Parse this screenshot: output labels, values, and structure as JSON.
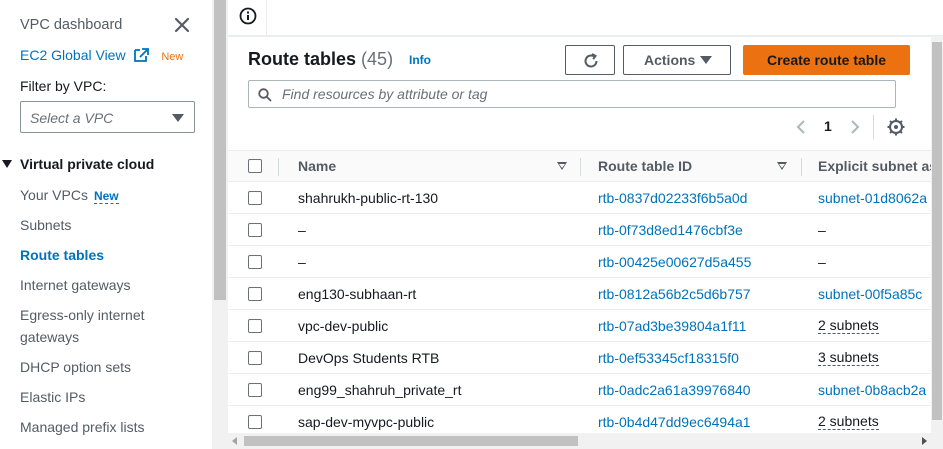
{
  "sidebar": {
    "title": "VPC dashboard",
    "ec2_link": "EC2 Global View",
    "ec2_badge": "New",
    "filter_label": "Filter by VPC:",
    "filter_placeholder": "Select a VPC",
    "section": "Virtual private cloud",
    "items": [
      {
        "label": "Your VPCs",
        "badge": "New"
      },
      {
        "label": "Subnets"
      },
      {
        "label": "Route tables"
      },
      {
        "label": "Internet gateways"
      },
      {
        "label": "Egress-only internet gateways"
      },
      {
        "label": "DHCP option sets"
      },
      {
        "label": "Elastic IPs"
      },
      {
        "label": "Managed prefix lists"
      }
    ]
  },
  "header": {
    "title": "Route tables",
    "count": "(45)",
    "info": "Info",
    "actions": "Actions",
    "create": "Create route table",
    "search_placeholder": "Find resources by attribute or tag",
    "page": "1"
  },
  "table": {
    "columns": [
      "Name",
      "Route table ID",
      "Explicit subnet as"
    ],
    "rows": [
      {
        "name": "shahrukh-public-rt-130",
        "id": "rtb-0837d02233f6b5a0d",
        "subnet": "subnet-01d8062a"
      },
      {
        "name": "–",
        "id": "rtb-0f73d8ed1476cbf3e",
        "subnet": "–"
      },
      {
        "name": "–",
        "id": "rtb-00425e00627d5a455",
        "subnet": "–"
      },
      {
        "name": "eng130-subhaan-rt",
        "id": "rtb-0812a56b2c5d6b757",
        "subnet": "subnet-00f5a85c"
      },
      {
        "name": "vpc-dev-public",
        "id": "rtb-07ad3be39804a1f11",
        "subnet": "2 subnets"
      },
      {
        "name": "DevOps Students RTB",
        "id": "rtb-0ef53345cf18315f0",
        "subnet": "3 subnets"
      },
      {
        "name": "eng99_shahruh_private_rt",
        "id": "rtb-0adc2a61a39976840",
        "subnet": "subnet-0b8acb2a"
      },
      {
        "name": "sap-dev-myvpc-public",
        "id": "rtb-0b4d47dd9ec6494a1",
        "subnet": "2 subnets"
      }
    ]
  },
  "colors": {
    "accent": "#0073bb",
    "primary_button": "#ec7211",
    "badge_orange": "#ec7211"
  }
}
